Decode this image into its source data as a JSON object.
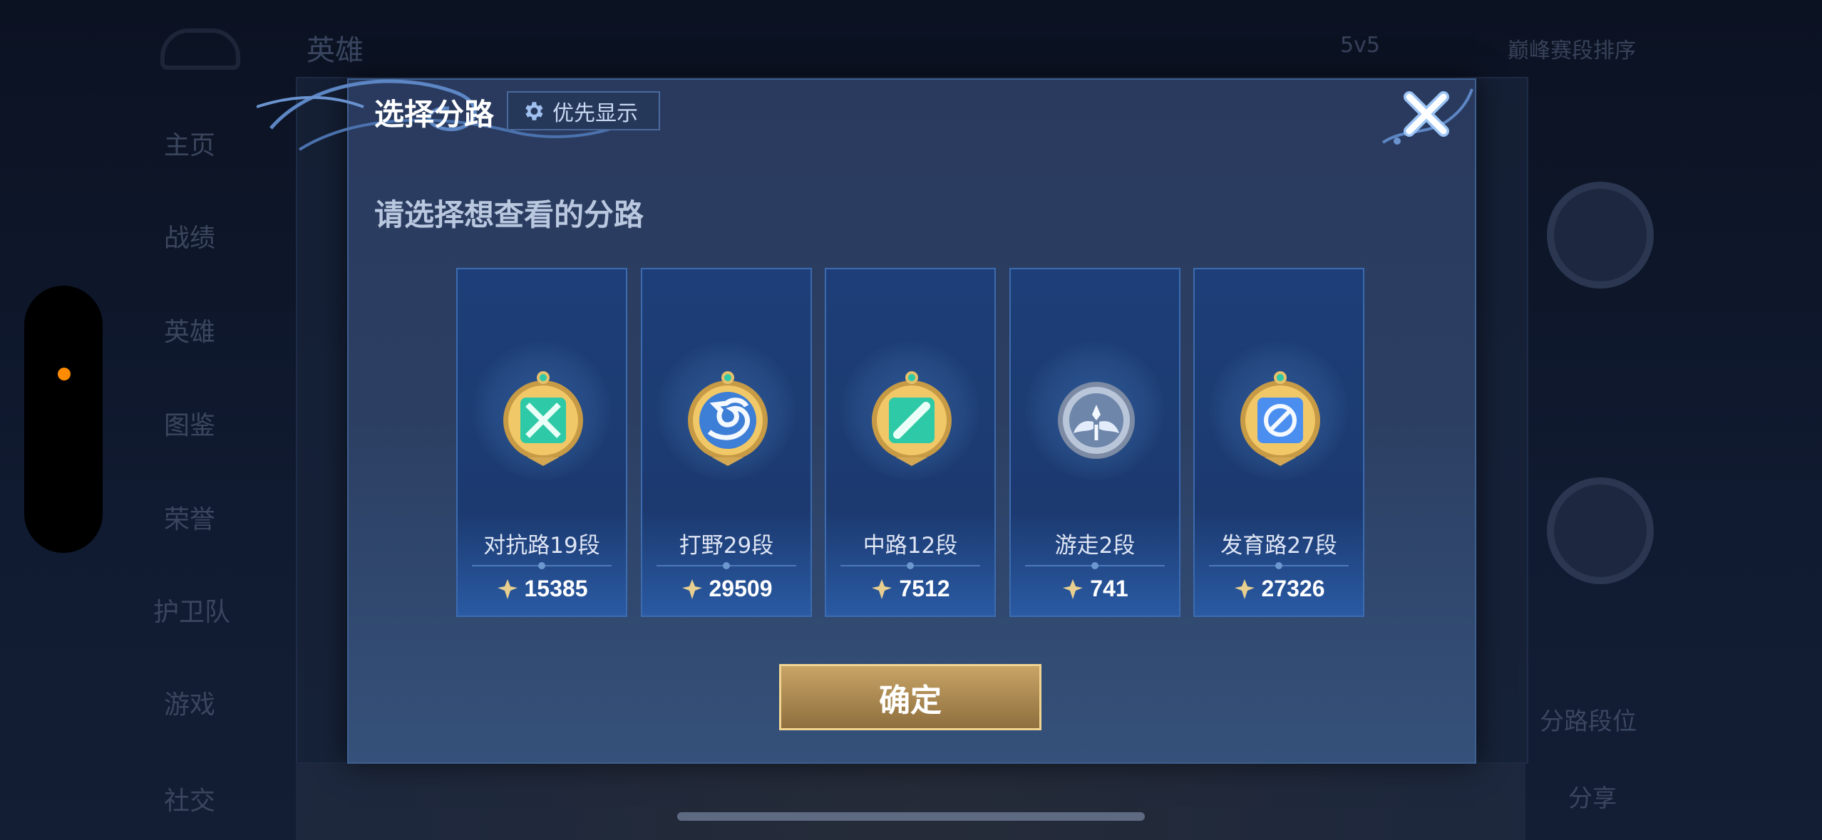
{
  "background": {
    "tabs": [
      "英雄",
      "5v5",
      "巅峰赛段排序"
    ],
    "sidebar": [
      "主页",
      "战绩",
      "英雄",
      "图鉴",
      "荣誉",
      "护卫队",
      "游戏",
      "社交"
    ],
    "right_labels": [
      "分路段位",
      "分享"
    ]
  },
  "dialog": {
    "title": "选择分路",
    "priority_label": "优先显示",
    "subtitle": "请选择想查看的分路",
    "confirm_label": "确定"
  },
  "lanes": [
    {
      "name": "对抗路19段",
      "score": "15385",
      "badge": "cross-swords-icon",
      "color": "#2ec9a6"
    },
    {
      "name": "打野29段",
      "score": "29509",
      "badge": "dragon-icon",
      "color": "#3d7ed6"
    },
    {
      "name": "中路12段",
      "score": "7512",
      "badge": "staff-icon",
      "color": "#2ec9a6"
    },
    {
      "name": "游走2段",
      "score": "741",
      "badge": "wings-icon",
      "color": "#a9b8cf"
    },
    {
      "name": "发育路27段",
      "score": "27326",
      "badge": "arrow-icon",
      "color": "#4a8ff0"
    }
  ],
  "colors": {
    "gold": "#c8a466",
    "accent": "#3c6bb0",
    "status_dot": "#ff8c00"
  }
}
